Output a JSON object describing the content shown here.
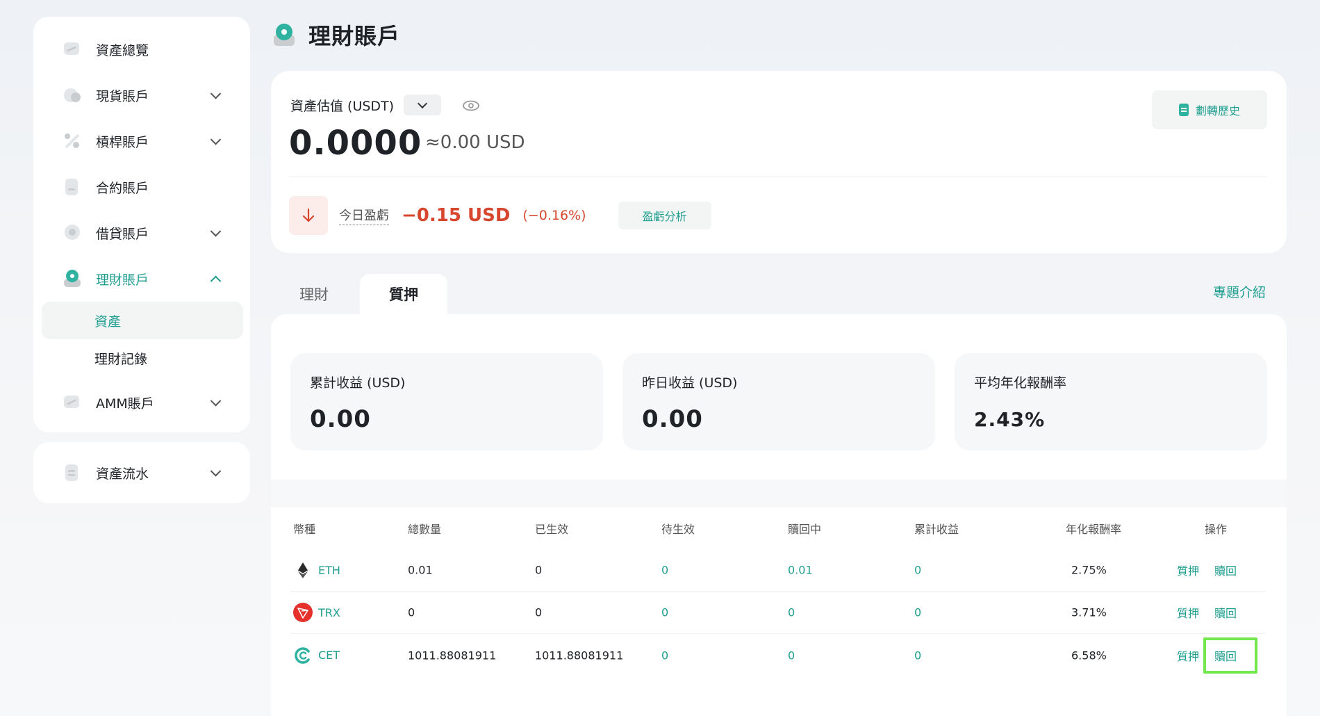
{
  "sidebar": {
    "items": [
      {
        "label": "資產總覽",
        "icon": "chart-icon"
      },
      {
        "label": "現貨賬戶",
        "icon": "coin-icon"
      },
      {
        "label": "槓桿賬戶",
        "icon": "percent-icon"
      },
      {
        "label": "合約賬戶",
        "icon": "document-icon"
      },
      {
        "label": "借貸賬戶",
        "icon": "loan-icon"
      },
      {
        "label": "理財賬戶",
        "icon": "wallet-icon"
      }
    ],
    "sub_items": [
      "資產",
      "理財記錄"
    ],
    "amm": "AMM賬戶",
    "flow": "資產流水"
  },
  "header": {
    "title": "理財賬戶"
  },
  "asset": {
    "est_label": "資產估值 (USDT)",
    "value": "0.0000",
    "approx": "≈0.00 USD",
    "transfer_label": "劃轉歷史",
    "pnl_label": "今日盈虧",
    "pnl_value": "−0.15 USD",
    "pnl_pct": "(−0.16%)",
    "analysis_label": "盈虧分析"
  },
  "tabs": [
    {
      "label": "理財"
    },
    {
      "label": "質押"
    }
  ],
  "topic_link": "專題介紹",
  "stats": [
    {
      "label": "累計收益 (USD)",
      "value": "0.00"
    },
    {
      "label": "昨日收益 (USD)",
      "value": "0.00"
    },
    {
      "label": "平均年化報酬率",
      "value": "2.43%"
    }
  ],
  "table": {
    "headers": [
      "幣種",
      "總數量",
      "已生效",
      "待生效",
      "贖回中",
      "累計收益",
      "年化報酬率",
      "操作"
    ],
    "rows": [
      {
        "coin": "ETH",
        "total": "0.01",
        "active": "0",
        "pending": "0",
        "redeeming": "0.01",
        "earnings": "0",
        "apr": "2.75%",
        "stake": "質押",
        "redeem": "贖回"
      },
      {
        "coin": "TRX",
        "total": "0",
        "active": "0",
        "pending": "0",
        "redeeming": "0",
        "earnings": "0",
        "apr": "3.71%",
        "stake": "質押",
        "redeem": "贖回"
      },
      {
        "coin": "CET",
        "total": "1011.88081911",
        "active": "1011.88081911",
        "pending": "0",
        "redeeming": "0",
        "earnings": "0",
        "apr": "6.58%",
        "stake": "質押",
        "redeem": "贖回"
      }
    ]
  },
  "colors": {
    "accent": "#1f9e8f",
    "loss": "#d7472f",
    "highlight": "#72e84c"
  }
}
